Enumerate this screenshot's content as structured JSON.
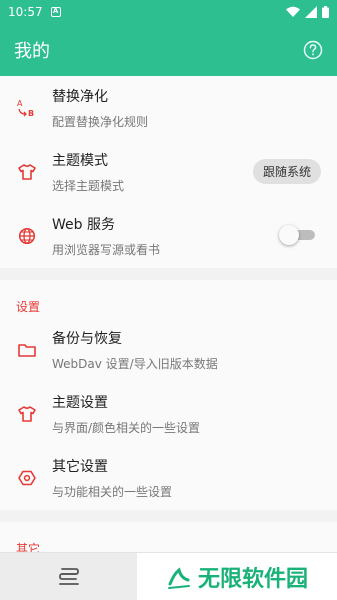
{
  "status_bar": {
    "time": "10:57",
    "app_icon_letter": "A"
  },
  "app_bar": {
    "title": "我的"
  },
  "items_top": [
    {
      "title": "替换净化",
      "summary": "配置替换净化规则"
    },
    {
      "title": "主题模式",
      "summary": "选择主题模式",
      "value": "跟随系统"
    },
    {
      "title": "Web 服务",
      "summary": "用浏览器写源或看书",
      "switch_on": false
    }
  ],
  "section_settings": {
    "header": "设置",
    "items": [
      {
        "title": "备份与恢复",
        "summary": "WebDav 设置/导入旧版本数据"
      },
      {
        "title": "主题设置",
        "summary": "与界面/颜色相关的一些设置"
      },
      {
        "title": "其它设置",
        "summary": "与功能相关的一些设置"
      }
    ]
  },
  "section_other": {
    "header": "其它"
  },
  "watermark": {
    "text": "无限软件园"
  },
  "colors": {
    "primary": "#2ebf91",
    "accent_red": "#e53935",
    "watermark_green": "#19b278"
  }
}
